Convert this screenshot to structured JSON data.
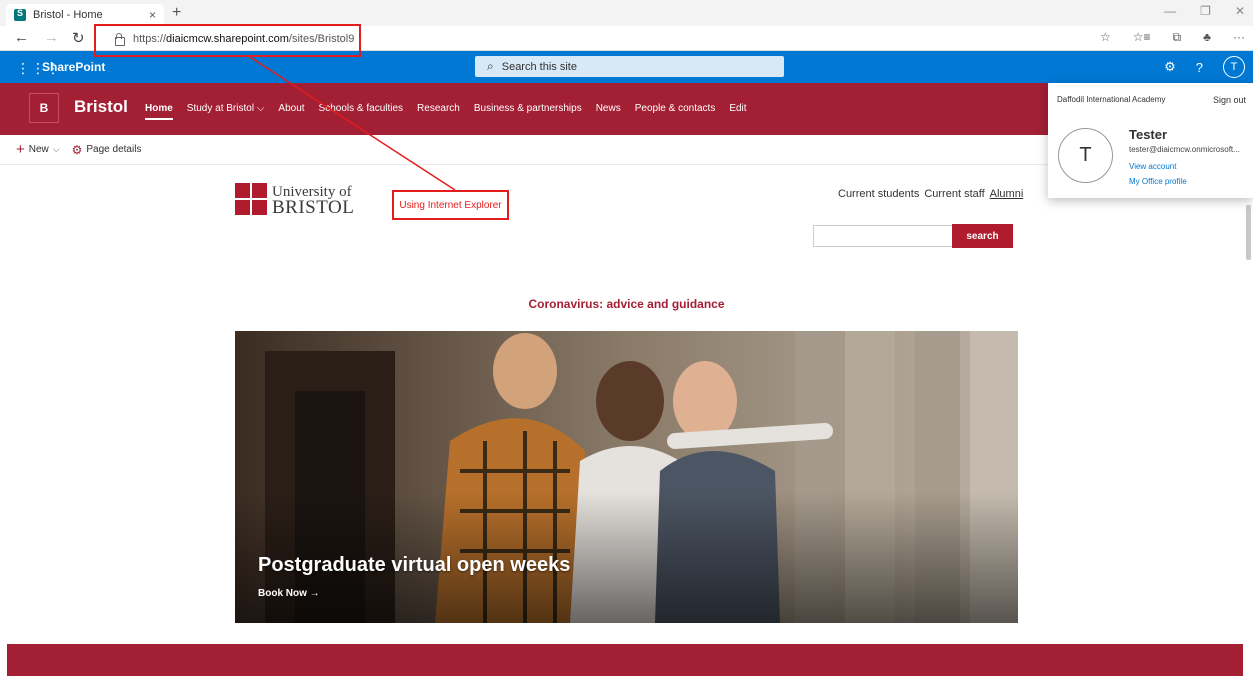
{
  "browser": {
    "tab_title": "Bristol - Home",
    "tab_close": "×",
    "new_tab": "+",
    "url_prefix": "https://",
    "url_host": "diaicmcw.sharepoint.com",
    "url_path": "/sites/Bristol9",
    "controls": [
      "—",
      "❐",
      "✕"
    ],
    "toolbar_icons": [
      "☆",
      "☆≡",
      "⧉",
      "♣",
      "···"
    ]
  },
  "annotation": {
    "label": "Using Internet Explorer",
    "color": "#e31c1c"
  },
  "suite": {
    "waffle": "⋮⋮⋮",
    "brand": "SharePoint",
    "search_placeholder": "Search this site",
    "settings_icon": "⚙",
    "help_icon": "?",
    "avatar_initial": "T",
    "accent": "#0078d4"
  },
  "site": {
    "logo_letter": "B",
    "title": "Bristol",
    "accent": "#a31f34",
    "nav": [
      {
        "label": "Home",
        "active": true
      },
      {
        "label": "Study at Bristol ⌵"
      },
      {
        "label": "About"
      },
      {
        "label": "Schools & faculties"
      },
      {
        "label": "Research"
      },
      {
        "label": "Business & partnerships"
      },
      {
        "label": "News"
      },
      {
        "label": "People & contacts"
      },
      {
        "label": "Edit"
      }
    ]
  },
  "command_bar": {
    "new_label": "New",
    "page_details_label": "Page details"
  },
  "account": {
    "org": "Daffodil International Academy",
    "sign_out": "Sign out",
    "initial": "T",
    "name": "Tester",
    "email": "tester@diaicmcw.onmicrosoft...",
    "view_account": "View account",
    "office_profile": "My Office profile"
  },
  "page": {
    "logo_line1": "University of",
    "logo_line2": "BRISTOL",
    "link_students": "Current students",
    "link_staff": "Current staff",
    "link_alumni": "Alumni",
    "search_button": "search",
    "covid_heading": "Coronavirus: advice and guidance",
    "hero_title": "Postgraduate virtual open weeks",
    "hero_cta": "Book Now →"
  }
}
